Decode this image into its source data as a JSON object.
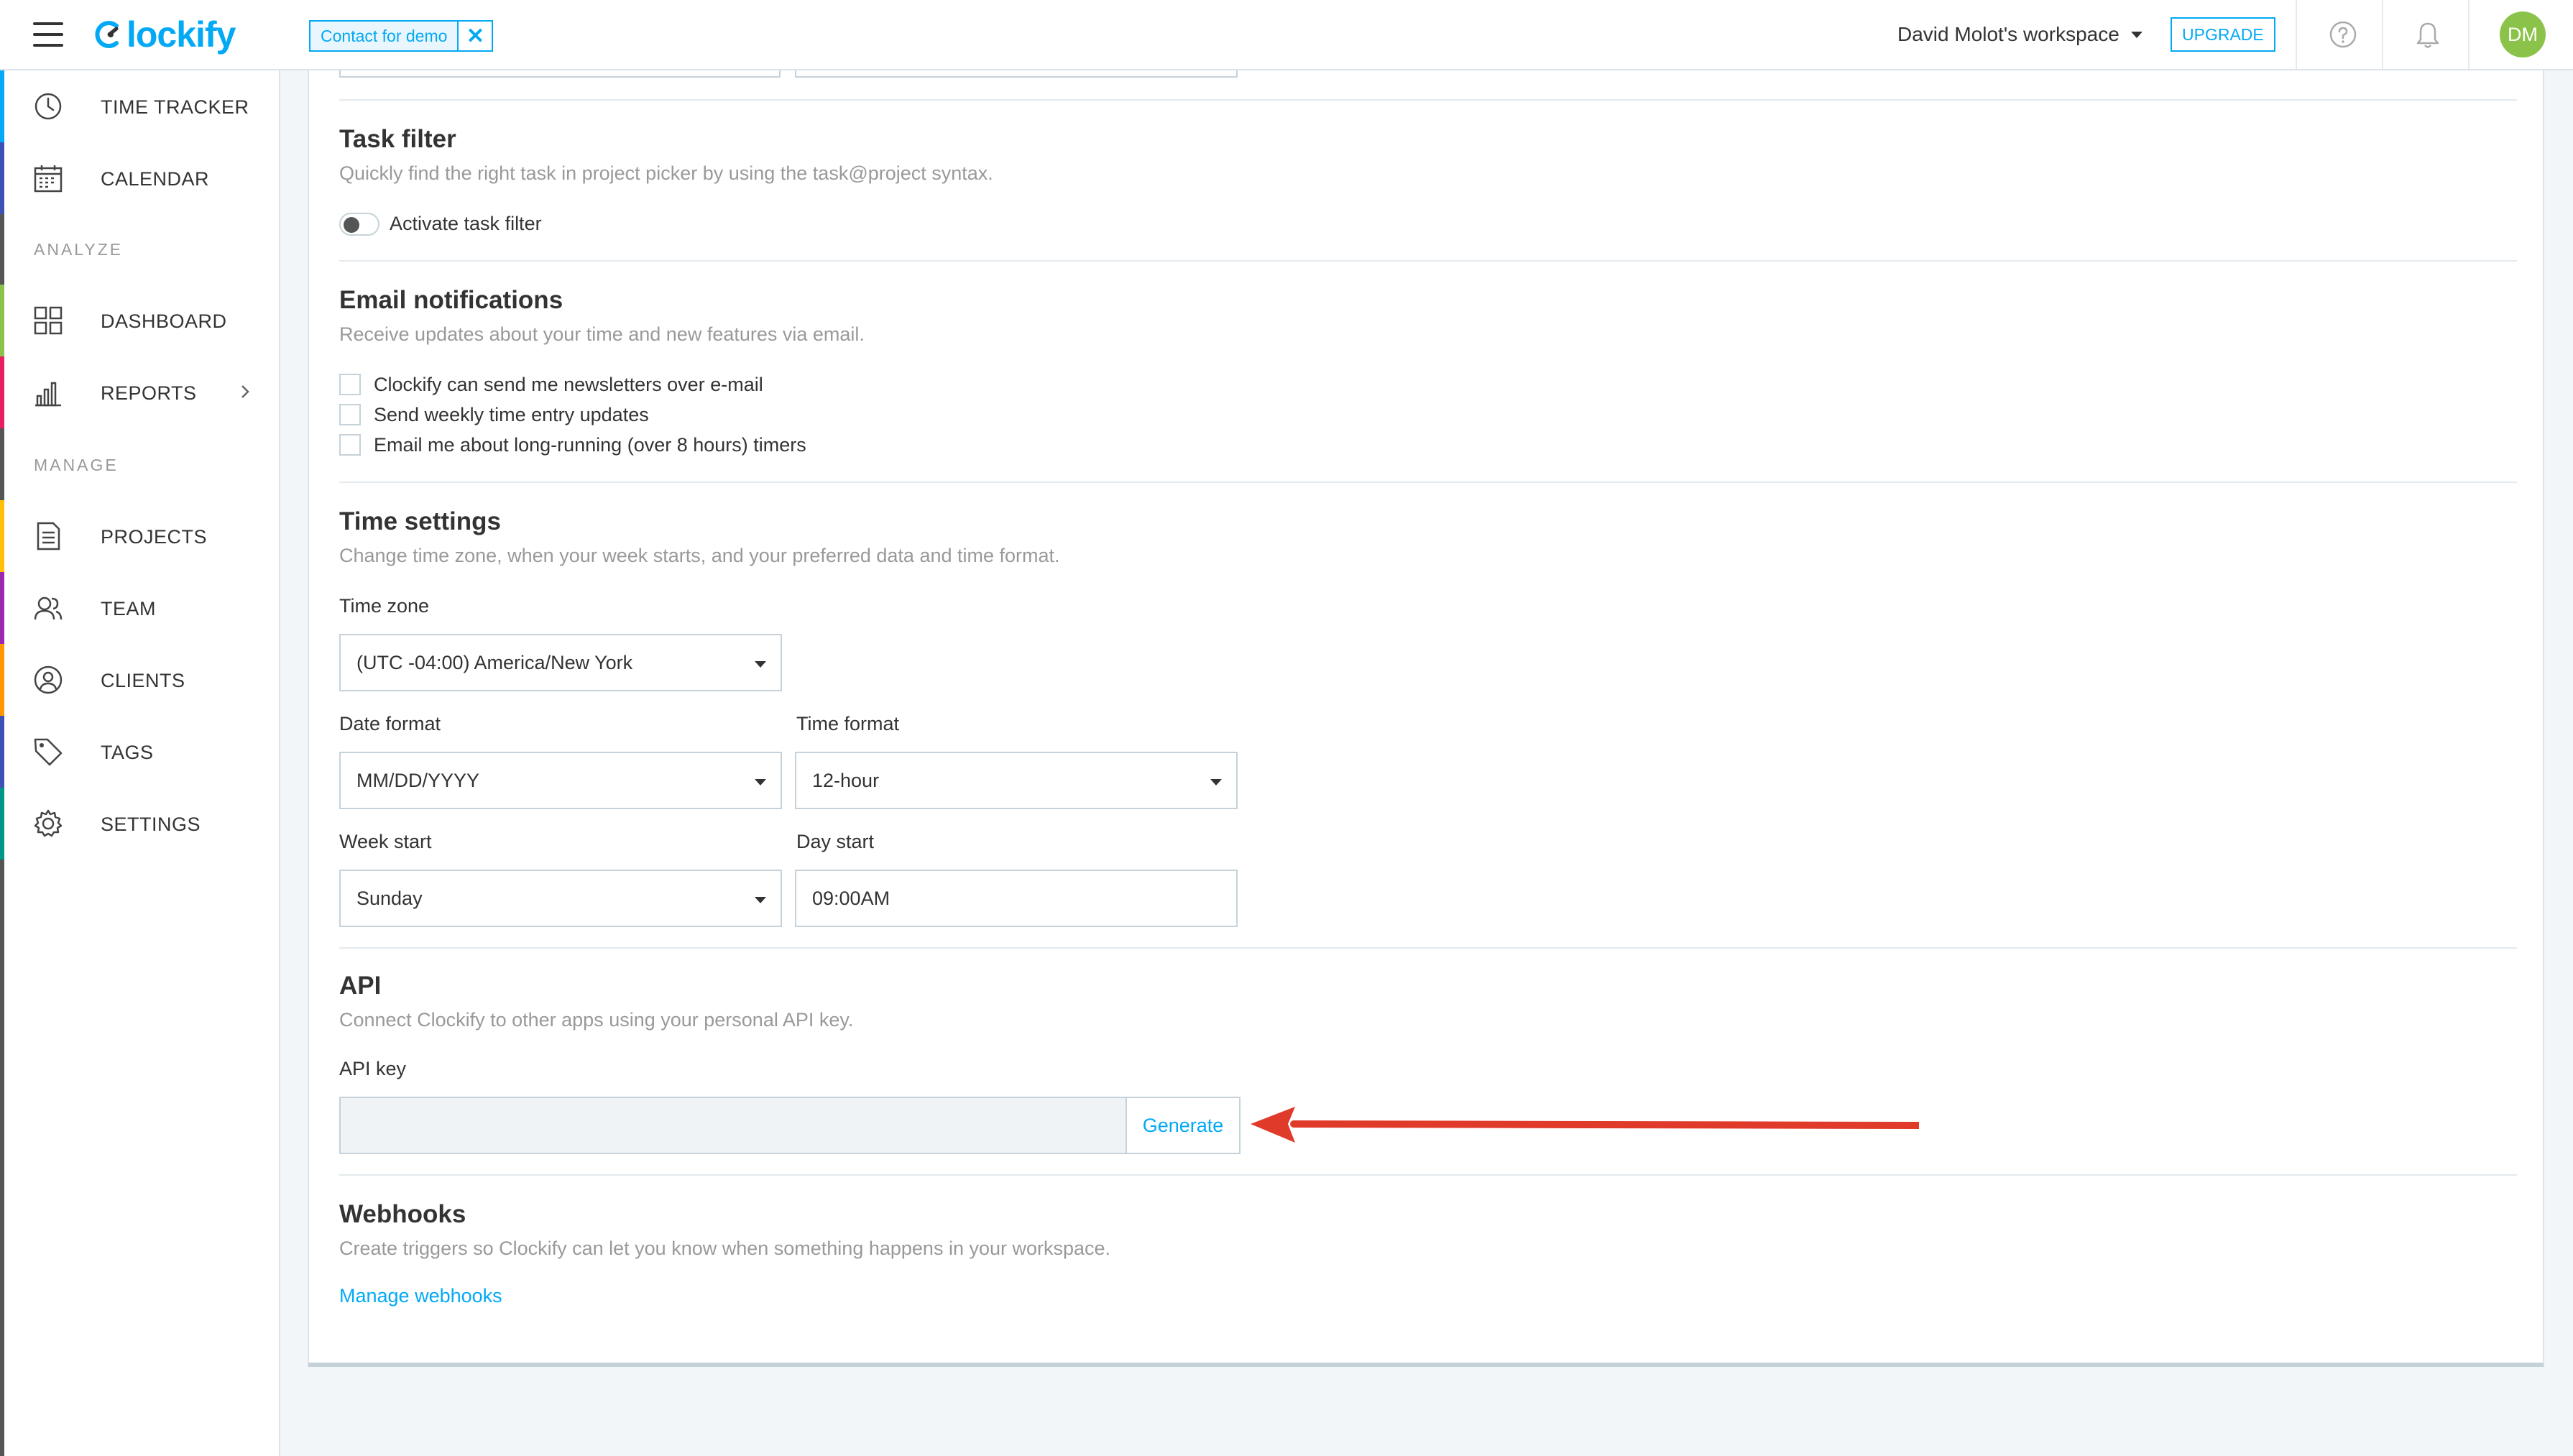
{
  "header": {
    "logo_text": "lockify",
    "demo_chip": "Contact for demo",
    "demo_close": "✕",
    "workspace": "David Molot's workspace",
    "upgrade": "UPGRADE",
    "avatar_initials": "DM",
    "colors": {
      "brand": "#03a9f4",
      "avatar": "#8bc34a"
    }
  },
  "sidebar": {
    "items": [
      {
        "label": "TIME TRACKER",
        "icon": "clock-icon",
        "accent": "#03a9f4"
      },
      {
        "label": "CALENDAR",
        "icon": "calendar-icon",
        "accent": "#3f51b5"
      },
      {
        "label": "DASHBOARD",
        "icon": "dashboard-grid-icon",
        "accent": "#8bc34a"
      },
      {
        "label": "REPORTS",
        "icon": "bar-chart-icon",
        "accent": "#e91e63"
      },
      {
        "label": "PROJECTS",
        "icon": "document-icon",
        "accent": "#ffc107"
      },
      {
        "label": "TEAM",
        "icon": "team-icon",
        "accent": "#9c27b0"
      },
      {
        "label": "CLIENTS",
        "icon": "client-user-icon",
        "accent": "#ff9800"
      },
      {
        "label": "TAGS",
        "icon": "tag-icon",
        "accent": "#3f51b5"
      },
      {
        "label": "SETTINGS",
        "icon": "gear-icon",
        "accent": "#009688"
      }
    ],
    "sections": {
      "analyze": "ANALYZE",
      "manage": "MANAGE"
    }
  },
  "task_filter": {
    "title": "Task filter",
    "description": "Quickly find the right task in project picker by using the task@project syntax.",
    "toggle_label": "Activate task filter"
  },
  "email": {
    "title": "Email notifications",
    "description": "Receive updates about your time and new features via email.",
    "options": [
      "Clockify can send me newsletters over e-mail",
      "Send weekly time entry updates",
      "Email me about long-running (over 8 hours) timers"
    ]
  },
  "time_settings": {
    "title": "Time settings",
    "description": "Change time zone, when your week starts, and your preferred data and time format.",
    "time_zone_label": "Time zone",
    "time_zone": "(UTC -04:00) America/New York",
    "date_format_label": "Date format",
    "date_format": "MM/DD/YYYY",
    "time_format_label": "Time format",
    "time_format": "12-hour",
    "week_start_label": "Week start",
    "week_start": "Sunday",
    "day_start_label": "Day start",
    "day_start": "09:00AM"
  },
  "api": {
    "title": "API",
    "description": "Connect Clockify to other apps using your personal API key.",
    "key_label": "API key",
    "key_value": "",
    "generate": "Generate",
    "annotation_color": "#e03a2b"
  },
  "webhooks": {
    "title": "Webhooks",
    "description": "Create triggers so Clockify can let you know when something happens in your workspace.",
    "link": "Manage webhooks"
  }
}
